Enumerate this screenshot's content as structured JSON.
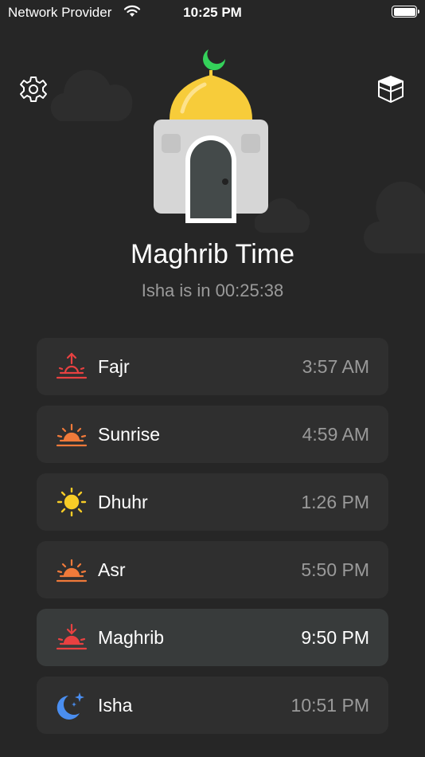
{
  "status_bar": {
    "carrier": "Network Provider",
    "time": "10:25 PM"
  },
  "header": {
    "title": "Maghrib Time",
    "subtitle": "Isha is in 00:25:38"
  },
  "prayers": [
    {
      "name": "Fajr",
      "time": "3:57 AM",
      "icon": "sun-up-arrow-icon",
      "color": "#e84141"
    },
    {
      "name": "Sunrise",
      "time": "4:59 AM",
      "icon": "sunrise-icon",
      "color": "#f07a3a"
    },
    {
      "name": "Dhuhr",
      "time": "1:26 PM",
      "icon": "sun-icon",
      "color": "#f7cc27"
    },
    {
      "name": "Asr",
      "time": "5:50 PM",
      "icon": "sunset-icon",
      "color": "#f07a3a"
    },
    {
      "name": "Maghrib",
      "time": "9:50 PM",
      "icon": "sun-down-arrow-icon",
      "color": "#e84141",
      "active": true
    },
    {
      "name": "Isha",
      "time": "10:51 PM",
      "icon": "moon-stars-icon",
      "color": "#4a8ef0"
    }
  ],
  "colors": {
    "background": "#262626",
    "card": "#2f2f2f",
    "card_active": "#383b3b",
    "dome": "#f7cc3a",
    "crescent": "#34d15a",
    "mosque_body": "#d6d6d6",
    "door": "#444a4a"
  }
}
